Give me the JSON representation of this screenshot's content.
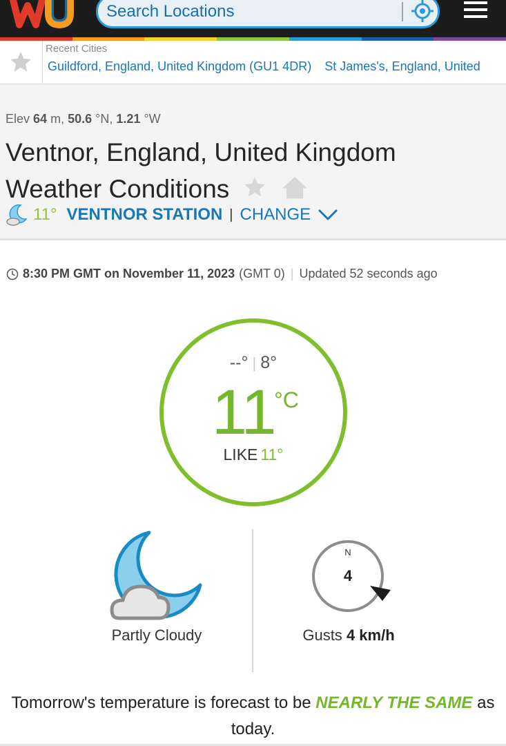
{
  "header_bar": {
    "search_placeholder": "Search Locations",
    "brand_colors": [
      "#e03a2b",
      "#f39c1e",
      "#f6d12a",
      "#8dc63f",
      "#2a9bd6",
      "#1a5fa8",
      "#7e4a9e"
    ]
  },
  "recent": {
    "label": "Recent Cities",
    "cities": [
      "Guildford, England, United Kingdom (GU1 4DR)",
      "St James's, England, United"
    ]
  },
  "location": {
    "elev_label": "Elev",
    "elev_value": "64",
    "elev_unit": "m,",
    "lat_value": "50.6",
    "lat_unit": "°N,",
    "lon_value": "1.21",
    "lon_unit": "°W",
    "title_line1": "Ventnor, England, United Kingdom",
    "title_line2": "Weather Conditions"
  },
  "station": {
    "temp": "11°",
    "name": "VENTNOR STATION",
    "separator": "|",
    "change_label": "CHANGE"
  },
  "timestamp": {
    "time": "8:30 PM GMT on November 11, 2023",
    "timezone": "(GMT 0)",
    "separator": "|",
    "updated": "Updated 52 seconds ago"
  },
  "current": {
    "high": "--°",
    "low": "8°",
    "separator": "|",
    "temp": "11",
    "unit": "°C",
    "feels_label": "LIKE",
    "feels_value": "11°",
    "accent_color": "#7fbf2e"
  },
  "condition": {
    "icon": "partly-cloudy-night-icon",
    "text": "Partly Cloudy"
  },
  "wind": {
    "compass_label": "N",
    "speed": "4",
    "gusts_label": "Gusts",
    "gusts_value": "4 km/h"
  },
  "forecast": {
    "prefix": "Tomorrow's temperature is forecast to be",
    "emphasis": "NEARLY THE SAME",
    "suffix_inline": "as",
    "suffix_next": "today."
  }
}
